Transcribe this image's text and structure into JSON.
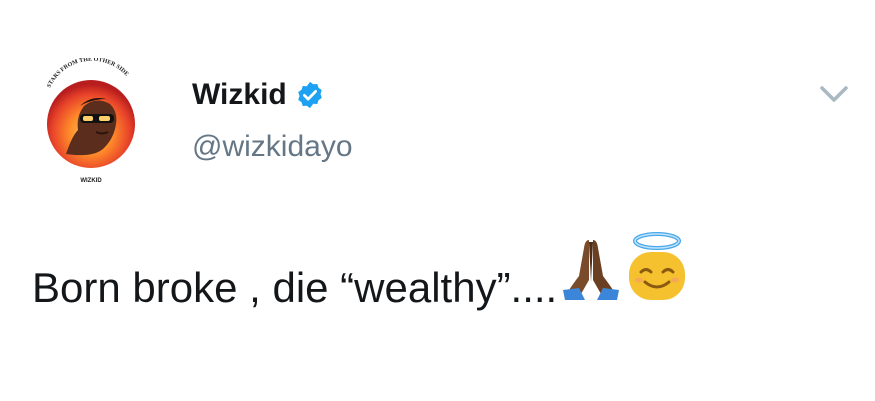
{
  "tweet": {
    "author": {
      "display_name": "Wizkid",
      "handle": "@wizkidayo",
      "verified": true,
      "avatar_caption_top": "STARS FROM THE OTHER SIDE",
      "avatar_caption_bottom": "WIZKID"
    },
    "text": "Born broke , die “wealthy”....",
    "emojis": [
      "folded-hands-emoji",
      "smiling-face-with-halo-emoji"
    ],
    "menu_icon": "chevron-down-icon"
  },
  "colors": {
    "text": "#14171a",
    "secondary_text": "#657786",
    "verified_blue": "#1da1f2",
    "chevron": "#aab8c2"
  }
}
